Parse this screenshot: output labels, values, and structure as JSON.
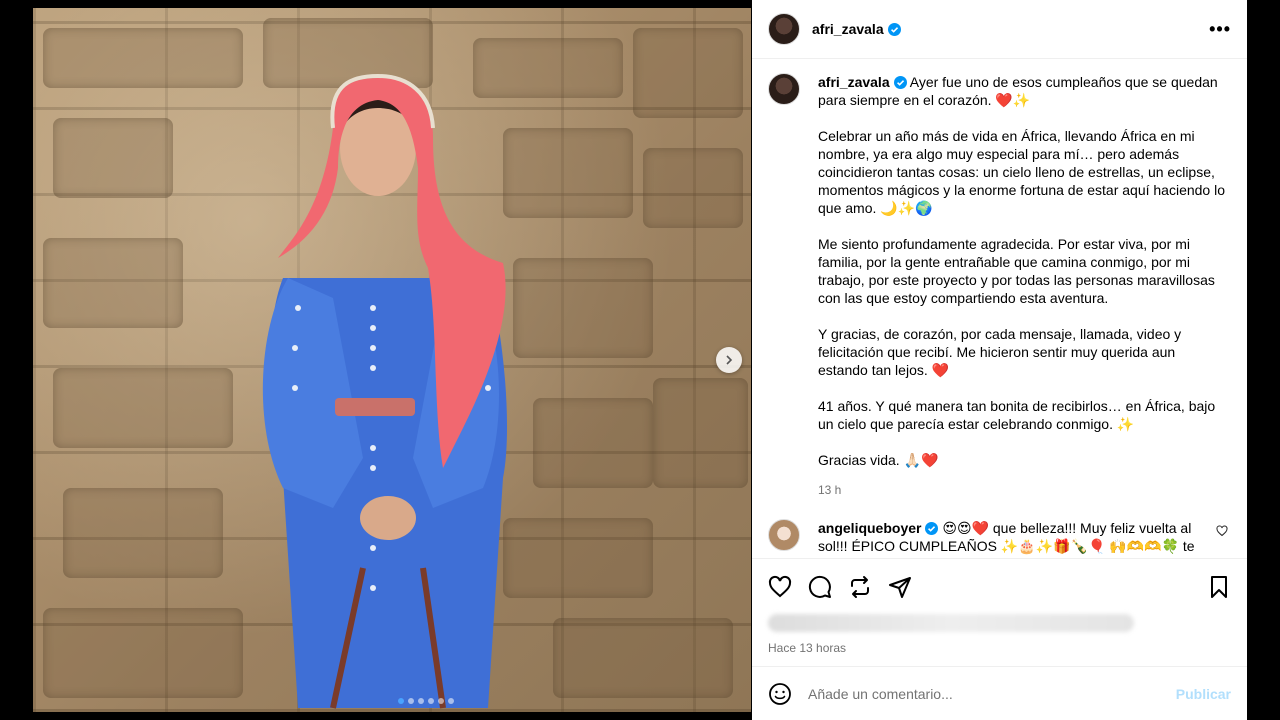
{
  "post": {
    "username": "afri_zavala",
    "more_label": "•••"
  },
  "caption": {
    "username": "afri_zavala",
    "p1": "Ayer fue uno de esos cumpleaños que se quedan para siempre en el corazón. ❤️✨",
    "p2": "Celebrar un año más de vida en África, llevando África en mi nombre, ya era algo muy especial para mí… pero además coincidieron tantas cosas: un cielo lleno de estrellas, un eclipse, momentos mágicos y la enorme fortuna de estar aquí haciendo lo que amo. 🌙✨🌍",
    "p3": "Me siento profundamente agradecida. Por estar viva, por mi familia, por la gente entrañable que camina conmigo, por mi trabajo, por este proyecto y por todas las personas maravillosas con las que estoy compartiendo esta aventura.",
    "p4": "Y gracias, de corazón, por cada mensaje, llamada, video y felicitación que recibí. Me hicieron sentir muy querida aun estando tan lejos. ❤️",
    "p5": "41 años. Y qué manera tan bonita de recibirlos… en África, bajo un cielo que parecía estar celebrando conmigo. ✨",
    "p6": "Gracias vida. 🙏🏻❤️",
    "time": "13 h"
  },
  "comment": {
    "username": "angeliqueboyer",
    "text": "😍😍❤️ que belleza!!! Muy feliz vuelta al sol!!! ÉPICO CUMPLEAÑOS ✨🎂✨🎁🍾🎈 🙌🫶🫶🍀 te quiero mucho"
  },
  "meta": {
    "posted_ago": "Hace 13 horas"
  },
  "add_comment": {
    "placeholder": "Añade un comentario...",
    "publish_label": "Publicar"
  },
  "colors": {
    "verified_blue": "#0095f6",
    "publish_disabled": "#b2dffc",
    "secondary_text": "#737373"
  },
  "carousel": {
    "slides": 6,
    "active_index": 0
  }
}
